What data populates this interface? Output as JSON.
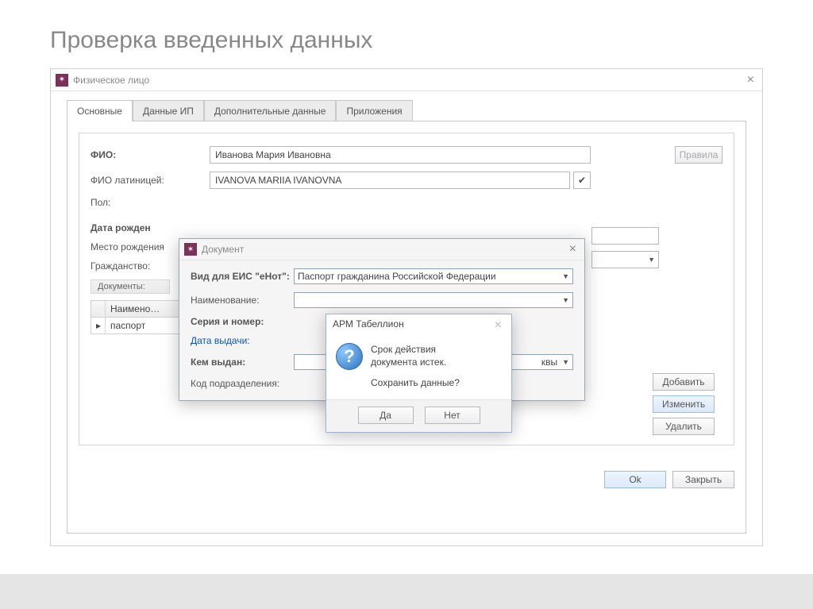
{
  "page": {
    "title": "Проверка введенных данных"
  },
  "window": {
    "title": "Физическое лицо"
  },
  "tabs": {
    "items": [
      {
        "label": "Основные"
      },
      {
        "label": "Данные ИП"
      },
      {
        "label": "Дополнительные данные"
      },
      {
        "label": "Приложения"
      }
    ]
  },
  "form": {
    "fio_label": "ФИО:",
    "fio_value": "Иванова Мария Ивановна",
    "fio_latin_label": "ФИО латиницей:",
    "fio_latin_value": "IVANOVA MARIIA IVANOVNA",
    "gender_label": "Пол:",
    "birth_date_label": "Дата рожден",
    "birth_place_label": "Место рождения",
    "citizenship_label": "Гражданство:",
    "docs_header": "Документы:",
    "rules_btn": "Правила",
    "grid_col": "Наимено…",
    "grid_val": "паспорт",
    "add_btn": "Добавить",
    "edit_btn": "Изменить",
    "del_btn": "Удалить",
    "ok_btn": "Ok",
    "close_btn": "Закрыть"
  },
  "doc_dialog": {
    "title": "Документ",
    "type_label": "Вид для ЕИС \"еНот\":",
    "type_value": "Паспорт гражданина Российской Федерации",
    "name_label": "Наименование:",
    "series_label": "Серия и номер:",
    "issue_date_label": "Дата выдачи:",
    "issued_by_label": "Кем выдан:",
    "issued_by_value": "квы",
    "dept_code_label": "Код подразделения:"
  },
  "msg_dialog": {
    "title": "АРМ Табеллион",
    "line1": "Срок действия",
    "line2": "документа истек.",
    "line3": "Сохранить данные?",
    "yes": "Да",
    "no": "Нет"
  }
}
